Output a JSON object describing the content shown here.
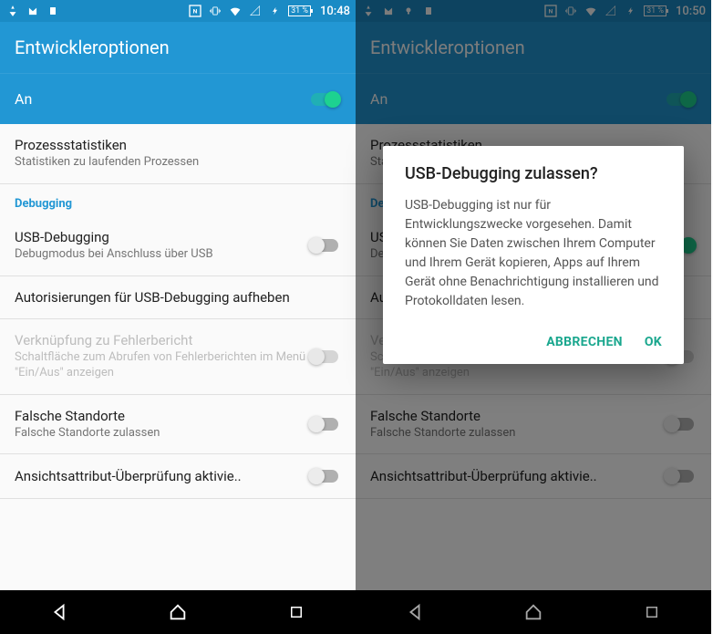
{
  "left": {
    "status": {
      "battery": "31 %",
      "time": "10:48"
    },
    "title": "Entwickleroptionen",
    "master": {
      "label": "An",
      "on": true
    },
    "items": [
      {
        "title": "Prozessstatistiken",
        "sub": "Statistiken zu laufenden Prozessen"
      },
      {
        "header": "Debugging"
      },
      {
        "title": "USB-Debugging",
        "sub": "Debugmodus bei Anschluss über USB",
        "switch": true,
        "on": false
      },
      {
        "title": "Autorisierungen für USB-Debugging aufheben"
      },
      {
        "title": "Verknüpfung zu Fehlerbericht",
        "sub": "Schaltfläche zum Abrufen von Fehlerberichten im Menü \"Ein/Aus\" anzeigen",
        "switch": true,
        "on": false,
        "disabled": true
      },
      {
        "title": "Falsche Standorte",
        "sub": "Falsche Standorte zulassen",
        "switch": true,
        "on": false
      },
      {
        "title": "Ansichtsattribut-Überprüfung aktivie..",
        "switch": true,
        "on": false
      }
    ]
  },
  "right": {
    "status": {
      "battery": "31 %",
      "time": "10:50"
    },
    "title": "Entwickleroptionen",
    "master": {
      "label": "An",
      "on": true
    },
    "items": [
      {
        "title": "Prozessstatistiken",
        "sub": "Statistiken zu laufenden Prozessen"
      },
      {
        "header": "Debugging"
      },
      {
        "title": "USB-Debugging",
        "sub": "Debugmodus bei Anschluss über USB",
        "switch": true,
        "on": true
      },
      {
        "title": "Autorisierungen für USB-Debugging aufheben"
      },
      {
        "title": "Verknüpfung zu Fehlerbericht",
        "sub": "Schaltfläche zum Abrufen von Fehlerberichten im Menü \"Ein/Aus\" anzeigen",
        "switch": true,
        "on": false,
        "disabled": true
      },
      {
        "title": "Falsche Standorte",
        "sub": "Falsche Standorte zulassen",
        "switch": true,
        "on": false
      },
      {
        "title": "Ansichtsattribut-Überprüfung aktivie..",
        "switch": true,
        "on": false
      }
    ],
    "dialog": {
      "title": "USB-Debugging zulassen?",
      "body": "USB-Debugging ist nur für Entwicklungszwecke vorgesehen. Damit können Sie Daten zwischen Ihrem Computer und Ihrem Gerät kopieren, Apps auf Ihrem Gerät ohne Benachrichtigung installieren und Protokolldaten lesen.",
      "cancel": "Abbrechen",
      "ok": "OK"
    }
  }
}
